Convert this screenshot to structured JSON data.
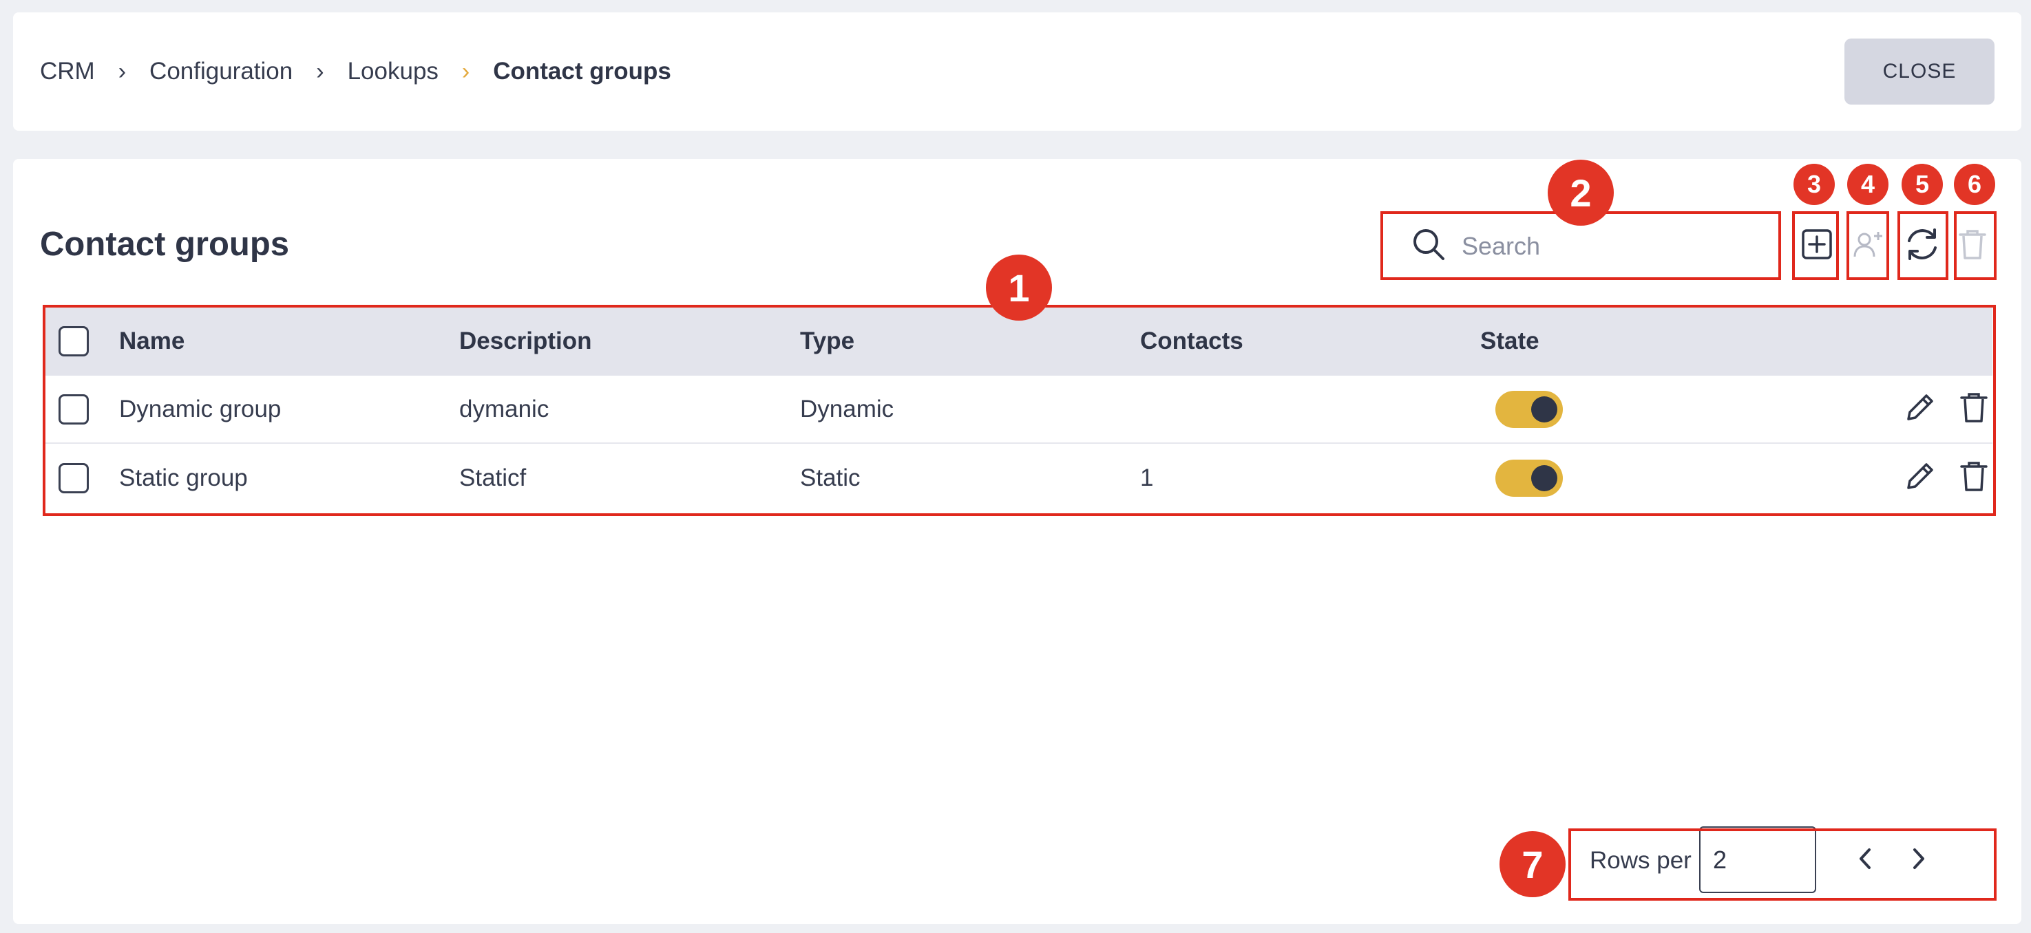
{
  "breadcrumb": {
    "items": [
      "CRM",
      "Configuration",
      "Lookups"
    ],
    "current": "Contact groups",
    "separator": "›"
  },
  "header": {
    "close_label": "CLOSE"
  },
  "page": {
    "title": "Contact groups"
  },
  "search": {
    "placeholder": "Search",
    "icon": "search-icon"
  },
  "toolbar": {
    "add_icon": "plus-square-icon",
    "add_user_icon": "user-plus-icon",
    "refresh_icon": "refresh-icon",
    "delete_icon": "trash-icon"
  },
  "table": {
    "columns": [
      "Name",
      "Description",
      "Type",
      "Contacts",
      "State"
    ],
    "rows": [
      {
        "name": "Dynamic group",
        "description": "dymanic",
        "type": "Dynamic",
        "contacts": "",
        "state": "on"
      },
      {
        "name": "Static group",
        "description": "Staticf",
        "type": "Static",
        "contacts": "1",
        "state": "on"
      }
    ]
  },
  "pagination": {
    "label": "Rows per page:",
    "rows_per_page": "2"
  },
  "annotations": [
    "1",
    "2",
    "3",
    "4",
    "5",
    "6",
    "7"
  ],
  "colors": {
    "accent": "#e3b53f",
    "annotation": "#e0281c",
    "header_bg": "#e3e4ec",
    "text": "#2f3547"
  }
}
